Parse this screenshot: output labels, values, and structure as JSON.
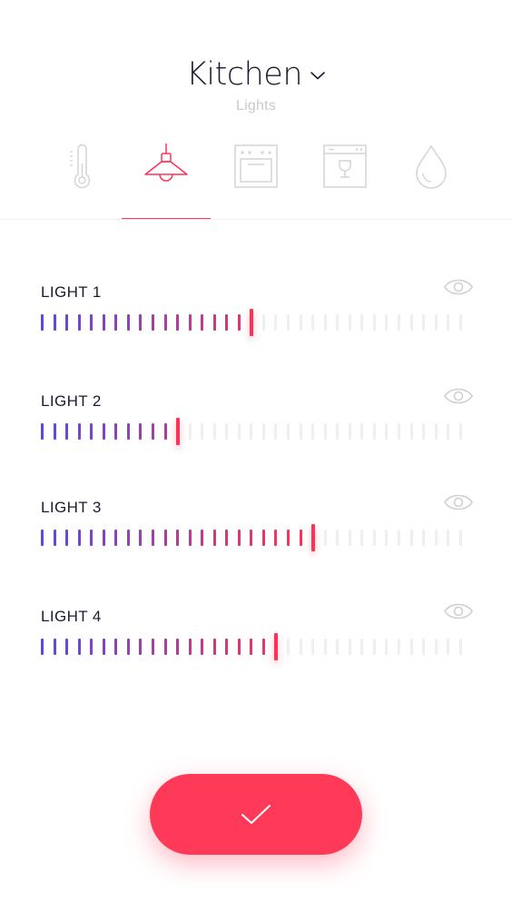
{
  "header": {
    "title": "Kitchen",
    "subtitle": "Lights"
  },
  "tabs": [
    {
      "icon": "thermometer-icon",
      "active": false
    },
    {
      "icon": "pendant-lamp-icon",
      "active": true
    },
    {
      "icon": "oven-icon",
      "active": false
    },
    {
      "icon": "dishwasher-icon",
      "active": false
    },
    {
      "icon": "water-drop-icon",
      "active": false
    }
  ],
  "lights": [
    {
      "label": "LIGHT 1",
      "level": 0.5
    },
    {
      "label": "LIGHT 2",
      "level": 0.33
    },
    {
      "label": "LIGHT 3",
      "level": 0.65
    },
    {
      "label": "LIGHT 4",
      "level": 0.56
    }
  ],
  "colors": {
    "accent": "#ff3a58",
    "gradient_start": "#5b4ae0",
    "gradient_end": "#ff3256",
    "inactive_tick": "#efeff2",
    "icon_inactive": "#d4d4d9"
  }
}
